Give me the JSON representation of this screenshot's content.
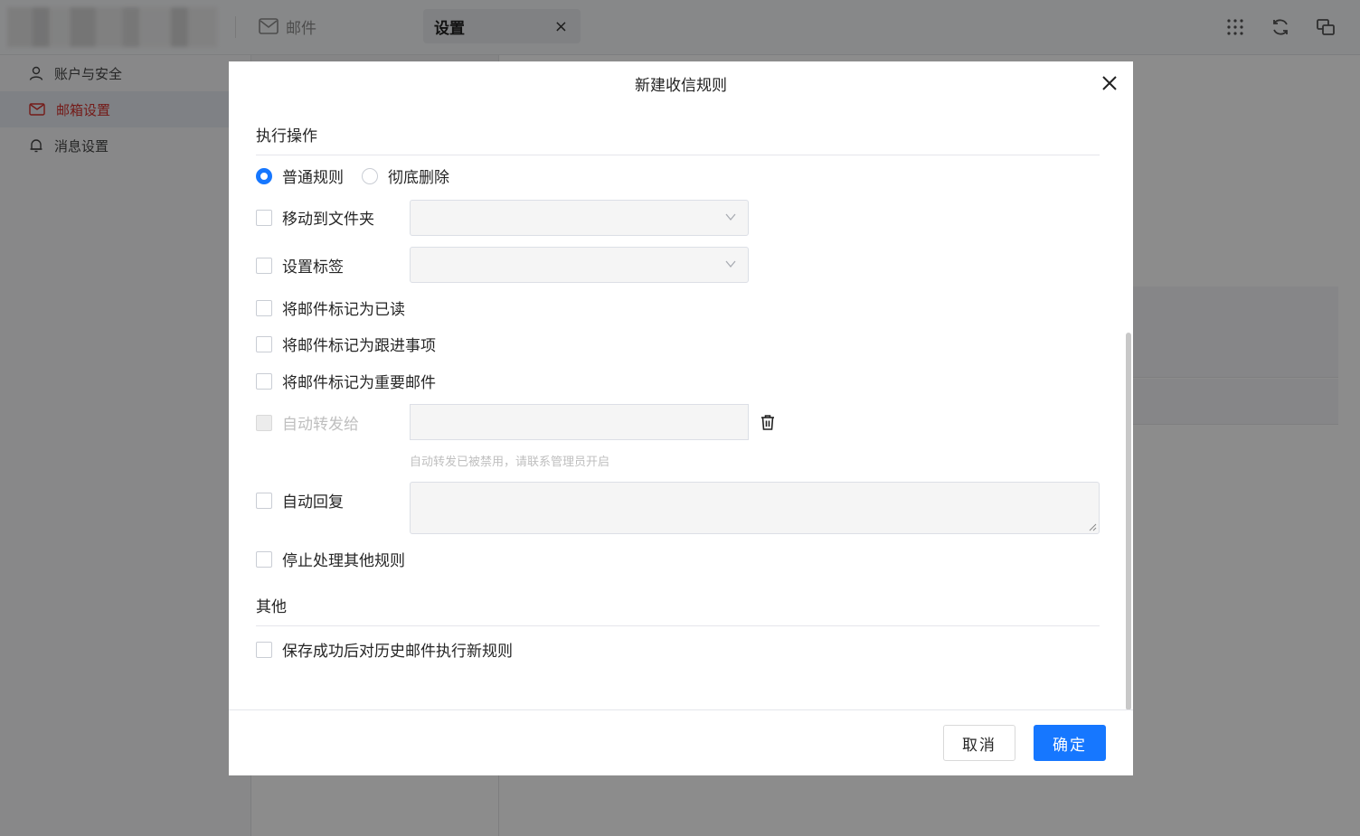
{
  "topbar": {
    "tabs": [
      {
        "label": "邮件",
        "icon": "mail-icon"
      },
      {
        "label": "设置",
        "close": "×"
      }
    ],
    "icons": [
      "apps-grid-icon",
      "refresh-icon",
      "switch-window-icon"
    ]
  },
  "sidebar": {
    "items": [
      {
        "label": "账户与安全",
        "icon": "user-icon",
        "active": false
      },
      {
        "label": "邮箱设置",
        "icon": "mail-settings-icon",
        "active": true
      },
      {
        "label": "消息设置",
        "icon": "bell-icon",
        "active": false
      }
    ]
  },
  "modal": {
    "title": "新建收信规则",
    "section_actions": "执行操作",
    "radio_normal": "普通规则",
    "radio_delete": "彻底删除",
    "move_to_folder": "移动到文件夹",
    "set_label": "设置标签",
    "mark_read": "将邮件标记为已读",
    "mark_followup": "将邮件标记为跟进事项",
    "mark_important": "将邮件标记为重要邮件",
    "auto_forward": "自动转发给",
    "auto_forward_hint": "自动转发已被禁用，请联系管理员开启",
    "auto_reply": "自动回复",
    "stop_rules": "停止处理其他规则",
    "section_other": "其他",
    "apply_history": "保存成功后对历史邮件执行新规则",
    "cancel": "取消",
    "confirm": "确定"
  },
  "colors": {
    "accent": "#1677ff",
    "active_sidebar_text": "#d4312c",
    "overlay": "rgba(0,0,0,0.45)"
  }
}
